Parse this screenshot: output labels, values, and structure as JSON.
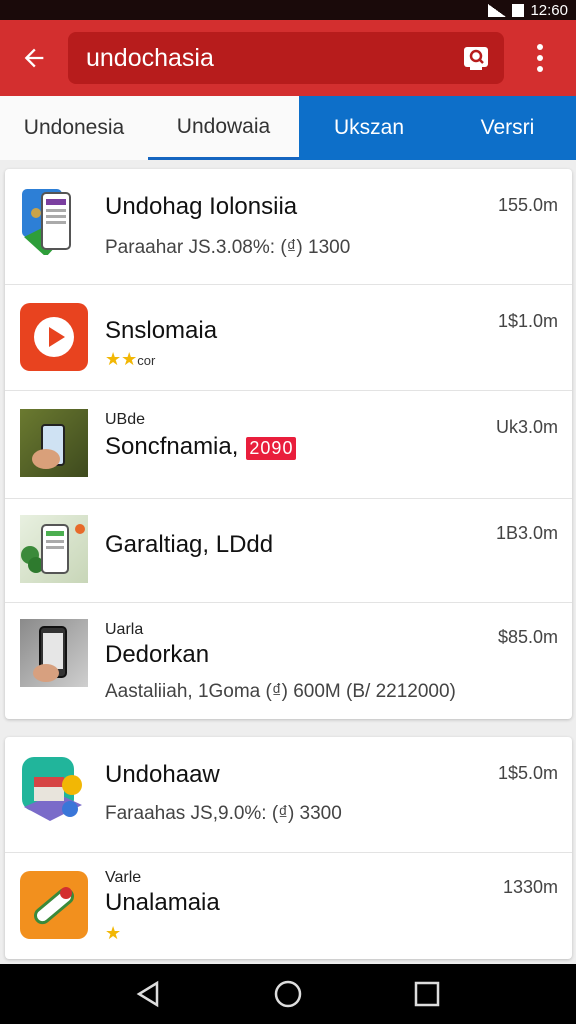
{
  "status_bar": {
    "time": "12:60"
  },
  "search": {
    "query": "undochasia"
  },
  "tabs": [
    {
      "label": "Undonesia"
    },
    {
      "label": "Undowaia"
    },
    {
      "label": "Ukszan"
    },
    {
      "label": "Versri"
    }
  ],
  "apps": [
    {
      "title": "Undohag Iolonsiia",
      "subtitle": "Paraahar JS.3.08%: (₫) 1300",
      "size": "155.0m"
    },
    {
      "title": "Snslomaia",
      "rating_text": "cor",
      "size": "1$1.0m"
    },
    {
      "overline": "UBde",
      "title": "Soncfnamia,",
      "badge": "2090",
      "size": "Uk3.0m"
    },
    {
      "title": "Garaltiag, LDdd",
      "size": "1B3.0m"
    },
    {
      "overline": "Uarla",
      "title": "Dedorkan",
      "subtitle": "Aastaliiah, 1Goma (₫) 600M (B/ 2212000)",
      "size": "$85.0m"
    },
    {
      "title": "Undohaaw",
      "subtitle": "Faraahas JS,9.0%: (₫) 3300",
      "size": "1$5.0m"
    },
    {
      "overline": "Varle",
      "title": "Unalamaia",
      "size": "1330m"
    }
  ]
}
